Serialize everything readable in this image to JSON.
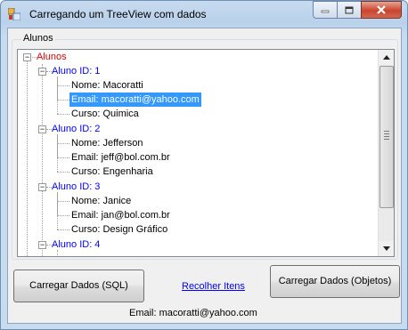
{
  "window": {
    "title": "Carregando um TreeView com dados"
  },
  "group": {
    "label": "Alunos"
  },
  "tree": {
    "root": "Alunos",
    "students": [
      {
        "id_label": "Aluno ID: 1",
        "nome": "Nome: Macoratti",
        "email": "Email: macoratti@yahoo.com",
        "curso": "Curso: Quimica"
      },
      {
        "id_label": "Aluno ID: 2",
        "nome": "Nome: Jefferson",
        "email": "Email: jeff@bol.com.br",
        "curso": "Curso: Engenharia"
      },
      {
        "id_label": "Aluno ID: 3",
        "nome": "Nome: Janice",
        "email": "Email: jan@bol.com.br",
        "curso": "Curso: Design Gráfico"
      },
      {
        "id_label": "Aluno ID: 4"
      }
    ],
    "selected_node": "Email: macoratti@yahoo.com"
  },
  "buttons": {
    "load_sql": "Carregar Dados (SQL)",
    "collapse": "Recolher Itens",
    "load_objects": "Carregar Dados (Objetos)"
  },
  "status": {
    "text": "Email: macoratti@yahoo.com"
  },
  "colors": {
    "root_node": "#e00000",
    "student_node": "#0000ff",
    "selection": "#3399ff"
  }
}
